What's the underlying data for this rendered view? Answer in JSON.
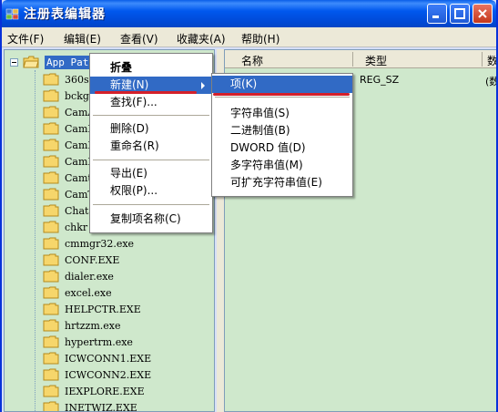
{
  "window": {
    "title": "注册表编辑器"
  },
  "menubar": [
    "文件(F)",
    "编辑(E)",
    "查看(V)",
    "收藏夹(A)",
    "帮助(H)"
  ],
  "tree": {
    "root_label": "App Paths",
    "items": [
      "360s",
      "bckg",
      "CamA",
      "CamM",
      "CamP",
      "CamR",
      "Camt",
      "CamT",
      "Chat",
      "chkr",
      "cmmgr32.exe",
      "CONF.EXE",
      "dialer.exe",
      "excel.exe",
      "HELPCTR.EXE",
      "hrtzzm.exe",
      "hypertrm.exe",
      "ICWCONN1.EXE",
      "ICWCONN2.EXE",
      "IEXPLORE.EXE",
      "INETWIZ.EXE"
    ]
  },
  "list": {
    "columns": [
      "名称",
      "类型",
      "数"
    ],
    "rows": [
      {
        "type": "REG_SZ",
        "data": "(数"
      }
    ]
  },
  "context_menu": {
    "items": [
      {
        "label": "折叠",
        "bold": true
      },
      {
        "label": "新建(N)",
        "highlight": true,
        "submenu": true
      },
      {
        "label": "查找(F)..."
      },
      {
        "label": "删除(D)"
      },
      {
        "label": "重命名(R)"
      },
      {
        "label": "导出(E)"
      },
      {
        "label": "权限(P)..."
      },
      {
        "label": "复制项名称(C)"
      }
    ]
  },
  "submenu": {
    "items": [
      {
        "label": "项(K)",
        "highlight": true
      },
      {
        "label": "字符串值(S)"
      },
      {
        "label": "二进制值(B)"
      },
      {
        "label": "DWORD 值(D)"
      },
      {
        "label": "多字符串值(M)"
      },
      {
        "label": "可扩充字符串值(E)"
      }
    ]
  },
  "colors": {
    "titlebar": "#0058ee",
    "pane_bg": "#cfe8cc",
    "highlight": "#316ac5",
    "annotation": "#d4202a"
  }
}
